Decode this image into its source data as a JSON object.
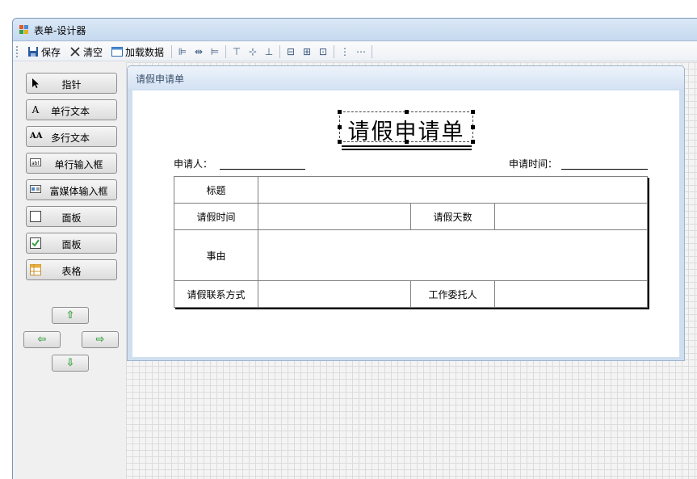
{
  "window": {
    "title": "表单-设计器"
  },
  "toolbar": {
    "save_label": "保存",
    "clear_label": "清空",
    "load_label": "加载数据"
  },
  "tools": [
    {
      "label": "指针",
      "icon": "pointer-icon"
    },
    {
      "label": "单行文本",
      "icon": "text-a-icon"
    },
    {
      "label": "多行文本",
      "icon": "multiline-text-icon"
    },
    {
      "label": "单行输入框",
      "icon": "textbox-icon"
    },
    {
      "label": "富媒体输入框",
      "icon": "rich-textbox-icon"
    },
    {
      "label": "面板",
      "icon": "panel-icon"
    },
    {
      "label": "面板",
      "icon": "checkbox-icon"
    },
    {
      "label": "表格",
      "icon": "table-icon"
    }
  ],
  "panel": {
    "title": "请假申请单"
  },
  "form": {
    "title": "请假申请单",
    "applicant_label": "申请人：",
    "apply_time_label": "申请时间：",
    "table": {
      "subject": "标题",
      "leave_time": "请假时间",
      "leave_days": "请假天数",
      "reason": "事由",
      "contact": "请假联系方式",
      "delegate": "工作委托人"
    }
  },
  "colors": {
    "accent": "#3aa040",
    "panel_border": "#9fb3cc",
    "titlebar": "#c5d9ef"
  }
}
